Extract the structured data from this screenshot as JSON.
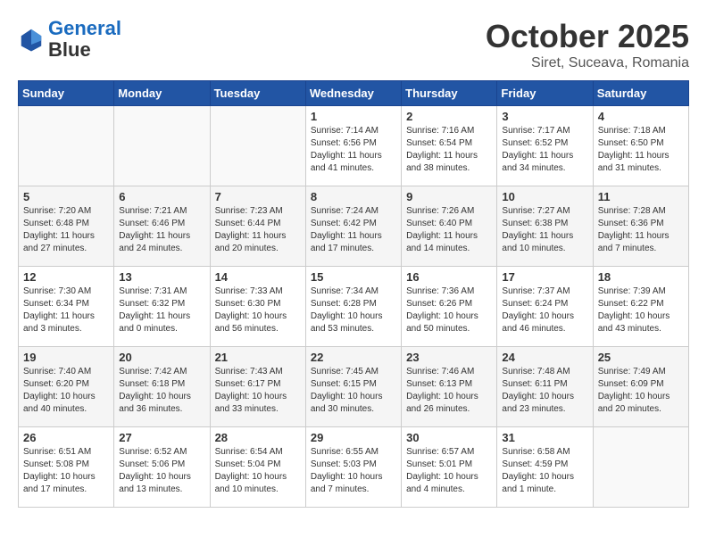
{
  "header": {
    "logo_line1": "General",
    "logo_line2": "Blue",
    "month": "October 2025",
    "location": "Siret, Suceava, Romania"
  },
  "days_of_week": [
    "Sunday",
    "Monday",
    "Tuesday",
    "Wednesday",
    "Thursday",
    "Friday",
    "Saturday"
  ],
  "weeks": [
    [
      {
        "day": "",
        "content": ""
      },
      {
        "day": "",
        "content": ""
      },
      {
        "day": "",
        "content": ""
      },
      {
        "day": "1",
        "content": "Sunrise: 7:14 AM\nSunset: 6:56 PM\nDaylight: 11 hours and 41 minutes."
      },
      {
        "day": "2",
        "content": "Sunrise: 7:16 AM\nSunset: 6:54 PM\nDaylight: 11 hours and 38 minutes."
      },
      {
        "day": "3",
        "content": "Sunrise: 7:17 AM\nSunset: 6:52 PM\nDaylight: 11 hours and 34 minutes."
      },
      {
        "day": "4",
        "content": "Sunrise: 7:18 AM\nSunset: 6:50 PM\nDaylight: 11 hours and 31 minutes."
      }
    ],
    [
      {
        "day": "5",
        "content": "Sunrise: 7:20 AM\nSunset: 6:48 PM\nDaylight: 11 hours and 27 minutes."
      },
      {
        "day": "6",
        "content": "Sunrise: 7:21 AM\nSunset: 6:46 PM\nDaylight: 11 hours and 24 minutes."
      },
      {
        "day": "7",
        "content": "Sunrise: 7:23 AM\nSunset: 6:44 PM\nDaylight: 11 hours and 20 minutes."
      },
      {
        "day": "8",
        "content": "Sunrise: 7:24 AM\nSunset: 6:42 PM\nDaylight: 11 hours and 17 minutes."
      },
      {
        "day": "9",
        "content": "Sunrise: 7:26 AM\nSunset: 6:40 PM\nDaylight: 11 hours and 14 minutes."
      },
      {
        "day": "10",
        "content": "Sunrise: 7:27 AM\nSunset: 6:38 PM\nDaylight: 11 hours and 10 minutes."
      },
      {
        "day": "11",
        "content": "Sunrise: 7:28 AM\nSunset: 6:36 PM\nDaylight: 11 hours and 7 minutes."
      }
    ],
    [
      {
        "day": "12",
        "content": "Sunrise: 7:30 AM\nSunset: 6:34 PM\nDaylight: 11 hours and 3 minutes."
      },
      {
        "day": "13",
        "content": "Sunrise: 7:31 AM\nSunset: 6:32 PM\nDaylight: 11 hours and 0 minutes."
      },
      {
        "day": "14",
        "content": "Sunrise: 7:33 AM\nSunset: 6:30 PM\nDaylight: 10 hours and 56 minutes."
      },
      {
        "day": "15",
        "content": "Sunrise: 7:34 AM\nSunset: 6:28 PM\nDaylight: 10 hours and 53 minutes."
      },
      {
        "day": "16",
        "content": "Sunrise: 7:36 AM\nSunset: 6:26 PM\nDaylight: 10 hours and 50 minutes."
      },
      {
        "day": "17",
        "content": "Sunrise: 7:37 AM\nSunset: 6:24 PM\nDaylight: 10 hours and 46 minutes."
      },
      {
        "day": "18",
        "content": "Sunrise: 7:39 AM\nSunset: 6:22 PM\nDaylight: 10 hours and 43 minutes."
      }
    ],
    [
      {
        "day": "19",
        "content": "Sunrise: 7:40 AM\nSunset: 6:20 PM\nDaylight: 10 hours and 40 minutes."
      },
      {
        "day": "20",
        "content": "Sunrise: 7:42 AM\nSunset: 6:18 PM\nDaylight: 10 hours and 36 minutes."
      },
      {
        "day": "21",
        "content": "Sunrise: 7:43 AM\nSunset: 6:17 PM\nDaylight: 10 hours and 33 minutes."
      },
      {
        "day": "22",
        "content": "Sunrise: 7:45 AM\nSunset: 6:15 PM\nDaylight: 10 hours and 30 minutes."
      },
      {
        "day": "23",
        "content": "Sunrise: 7:46 AM\nSunset: 6:13 PM\nDaylight: 10 hours and 26 minutes."
      },
      {
        "day": "24",
        "content": "Sunrise: 7:48 AM\nSunset: 6:11 PM\nDaylight: 10 hours and 23 minutes."
      },
      {
        "day": "25",
        "content": "Sunrise: 7:49 AM\nSunset: 6:09 PM\nDaylight: 10 hours and 20 minutes."
      }
    ],
    [
      {
        "day": "26",
        "content": "Sunrise: 6:51 AM\nSunset: 5:08 PM\nDaylight: 10 hours and 17 minutes."
      },
      {
        "day": "27",
        "content": "Sunrise: 6:52 AM\nSunset: 5:06 PM\nDaylight: 10 hours and 13 minutes."
      },
      {
        "day": "28",
        "content": "Sunrise: 6:54 AM\nSunset: 5:04 PM\nDaylight: 10 hours and 10 minutes."
      },
      {
        "day": "29",
        "content": "Sunrise: 6:55 AM\nSunset: 5:03 PM\nDaylight: 10 hours and 7 minutes."
      },
      {
        "day": "30",
        "content": "Sunrise: 6:57 AM\nSunset: 5:01 PM\nDaylight: 10 hours and 4 minutes."
      },
      {
        "day": "31",
        "content": "Sunrise: 6:58 AM\nSunset: 4:59 PM\nDaylight: 10 hours and 1 minute."
      },
      {
        "day": "",
        "content": ""
      }
    ]
  ]
}
